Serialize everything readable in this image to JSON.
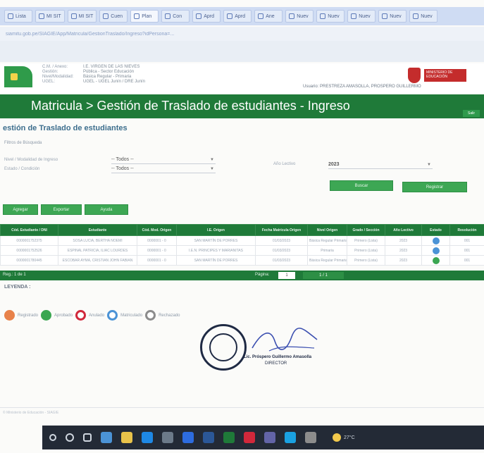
{
  "browser": {
    "tabs": [
      {
        "label": "Lista",
        "active": false
      },
      {
        "label": "MI SIT",
        "active": false
      },
      {
        "label": "MI SIT",
        "active": false
      },
      {
        "label": "Cuen",
        "active": false
      },
      {
        "label": "Plan",
        "active": true
      },
      {
        "label": "Con",
        "active": false
      },
      {
        "label": "Aprd",
        "active": false
      },
      {
        "label": "Aprd",
        "active": false
      },
      {
        "label": "Ane",
        "active": false
      },
      {
        "label": "Nuev",
        "active": false
      },
      {
        "label": "Nuev",
        "active": false
      },
      {
        "label": "Nuev",
        "active": false
      },
      {
        "label": "Nuev",
        "active": false
      },
      {
        "label": "Nuev",
        "active": false
      }
    ],
    "url": "siamitu.gob.pe/SIAGIE/App/Matricula/GestionTraslado/Ingreso?idPersona=..."
  },
  "header": {
    "school_info": [
      {
        "label": "C.M. / Anexo:",
        "value": "I.E. VIRGEN DE LAS NIEVES"
      },
      {
        "label": "Gestión:",
        "value": "Pública - Sector Educación"
      },
      {
        "label": "Nivel/Modalidad:",
        "value": "Básica Regular - Primaria"
      },
      {
        "label": "UGEL:",
        "value": "UGEL - UGEL Junín / DRE Junín"
      }
    ],
    "ministry": "MINISTERIO DE EDUCACIÓN",
    "user": "Usuario: PRESTREZA AMASOLLA, PROSPERO GUILLERMO"
  },
  "title_band": {
    "title": "Matricula > Gestión de Traslado de estudiantes - Ingreso",
    "mini_button": "Salir"
  },
  "page": {
    "subtitle": "estión de Traslado de estudiantes",
    "filter_caption": "Filtros de Búsqueda"
  },
  "filters": {
    "level_label": "Nivel / Modalidad de Ingreso",
    "level_value": "-- Todos --",
    "state_label": "Estado / Condición",
    "state_value": "-- Todos --",
    "year_label": "Año Lectivo",
    "year_value": "2023",
    "search_button": "Buscar",
    "register_button": "Registrar"
  },
  "actions": {
    "add": "Agregar",
    "export": "Exportar",
    "print": "Ayuda"
  },
  "table": {
    "columns": [
      "Cód. Estudiante / DNI",
      "Estudiante",
      "Cód. Mod. Origen",
      "I.E. Origen",
      "Fecha Matrícula Origen",
      "Nivel Origen",
      "Grado / Sección",
      "Año Lectivo",
      "Estado",
      "Resolución"
    ],
    "rows": [
      {
        "dni": "0000001752375",
        "student": "SOSA LUCIA, BERTHA NOEMI",
        "code": "0000001 - 0",
        "ie": "SAN MARTÍN DE PORRES",
        "date": "01/03/2023",
        "level": "Básica Regular Primaria",
        "grade": "Primero (Lista)",
        "year": "2023",
        "status": "blue",
        "res": "001"
      },
      {
        "dni": "0000001752526",
        "student": "ESPINAL PATRICIA, ILIAC LOURDES",
        "code": "0000001 - 0",
        "ie": "I.E.N. PRINCIPES Y MARIANITAS",
        "date": "01/03/2023",
        "level": "Primaria",
        "grade": "Primero (Lista)",
        "year": "2023",
        "status": "blue",
        "res": "001"
      },
      {
        "dni": "0000001780445",
        "student": "ESCOBAR AYMA, CRISTIAN JOHN FABIAN",
        "code": "0000001 - 0",
        "ie": "SAN MARTÍN DE PORRES",
        "date": "01/03/2023",
        "level": "Básica Regular Primaria",
        "grade": "Primero (Lista)",
        "year": "2023",
        "status": "green",
        "res": "001"
      }
    ]
  },
  "pager": {
    "records": "Reg.: 1 de 1",
    "page_label": "Página:",
    "page_value": "1",
    "nav": "1 / 1"
  },
  "legend": {
    "title": "LEYENDA :",
    "items": [
      {
        "label": "Registrado",
        "color": "#e8824a"
      },
      {
        "label": "Aprobado",
        "color": "#3aa651"
      },
      {
        "label": "Anulado",
        "color": "#d1283b"
      },
      {
        "label": "Matriculado",
        "color": "#4b93d6"
      },
      {
        "label": "Rechazado",
        "color": "#8c8c8c"
      }
    ]
  },
  "signature": {
    "name": "Lic. Próspero Guillermo Amasolla",
    "role": "DIRECTOR",
    "seal_text": "DIRECCIÓN"
  },
  "footer": {
    "text": "© Ministerio de Educación - SIAGIE"
  },
  "taskbar": {
    "icons": [
      "start-icon",
      "search-icon",
      "task-view-icon",
      "chrome-icon",
      "file-explorer-icon",
      "edge-icon",
      "store-icon",
      "mail-icon",
      "word-icon",
      "excel-icon",
      "powerpoint-icon",
      "teams-icon",
      "photos-icon",
      "settings-icon"
    ],
    "icon_colors": [
      "#cfd6df",
      "#cfd6df",
      "#cfd6df",
      "#4b93d6",
      "#e8c24a",
      "#1e88e5",
      "#6c7a89",
      "#2d6cdf",
      "#2b5797",
      "#1f7a39",
      "#d1283b",
      "#6264a7",
      "#1aa1e1",
      "#8c8c8c"
    ],
    "weather": "27°C"
  }
}
